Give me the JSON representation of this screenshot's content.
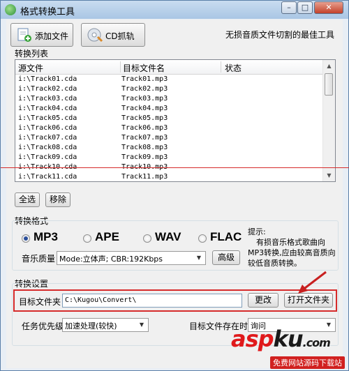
{
  "window": {
    "title": "格式转换工具"
  },
  "toolbar": {
    "add_file_label": "添加文件",
    "cd_rip_label": "CD抓轨",
    "tagline": "无损音质文件切割的最佳工具"
  },
  "list": {
    "section_label": "转换列表",
    "columns": [
      "源文件",
      "目标文件名",
      "状态"
    ],
    "rows": [
      {
        "src": "i:\\Track01.cda",
        "dst": "Track01.mp3",
        "status": ""
      },
      {
        "src": "i:\\Track02.cda",
        "dst": "Track02.mp3",
        "status": ""
      },
      {
        "src": "i:\\Track03.cda",
        "dst": "Track03.mp3",
        "status": ""
      },
      {
        "src": "i:\\Track04.cda",
        "dst": "Track04.mp3",
        "status": ""
      },
      {
        "src": "i:\\Track05.cda",
        "dst": "Track05.mp3",
        "status": ""
      },
      {
        "src": "i:\\Track06.cda",
        "dst": "Track06.mp3",
        "status": ""
      },
      {
        "src": "i:\\Track07.cda",
        "dst": "Track07.mp3",
        "status": ""
      },
      {
        "src": "i:\\Track08.cda",
        "dst": "Track08.mp3",
        "status": ""
      },
      {
        "src": "i:\\Track09.cda",
        "dst": "Track09.mp3",
        "status": ""
      },
      {
        "src": "i:\\Track10.cda",
        "dst": "Track10.mp3",
        "status": ""
      },
      {
        "src": "i:\\Track11.cda",
        "dst": "Track11.mp3",
        "status": ""
      }
    ],
    "select_all_label": "全选",
    "remove_label": "移除"
  },
  "format": {
    "section_label": "转换格式",
    "options": [
      "MP3",
      "APE",
      "WAV",
      "FLAC"
    ],
    "selected": "MP3",
    "quality_label": "音乐质量",
    "quality_value": "Mode:立体声; CBR:192Kbps",
    "advanced_label": "高级",
    "hint_title": "提示:",
    "hint_text": "有损音乐格式歌曲向MP3转换,应由较高音质向较低音质转换。"
  },
  "settings": {
    "section_label": "转换设置",
    "target_folder_label": "目标文件夹",
    "target_folder_value": "C:\\Kugou\\Convert\\",
    "change_label": "更改",
    "open_folder_label": "打开文件夹",
    "priority_label": "任务优先级",
    "priority_value": "加速处理(较快)",
    "exists_label": "目标文件存在时",
    "exists_value": "询问"
  },
  "watermark": {
    "text_a": "asp",
    "text_k": "ku",
    "text_tail": ".com",
    "sub": "免费网站源码下载站"
  },
  "colors": {
    "annotation_red": "#d62b2b",
    "title_bar": "#b9d1ea"
  }
}
